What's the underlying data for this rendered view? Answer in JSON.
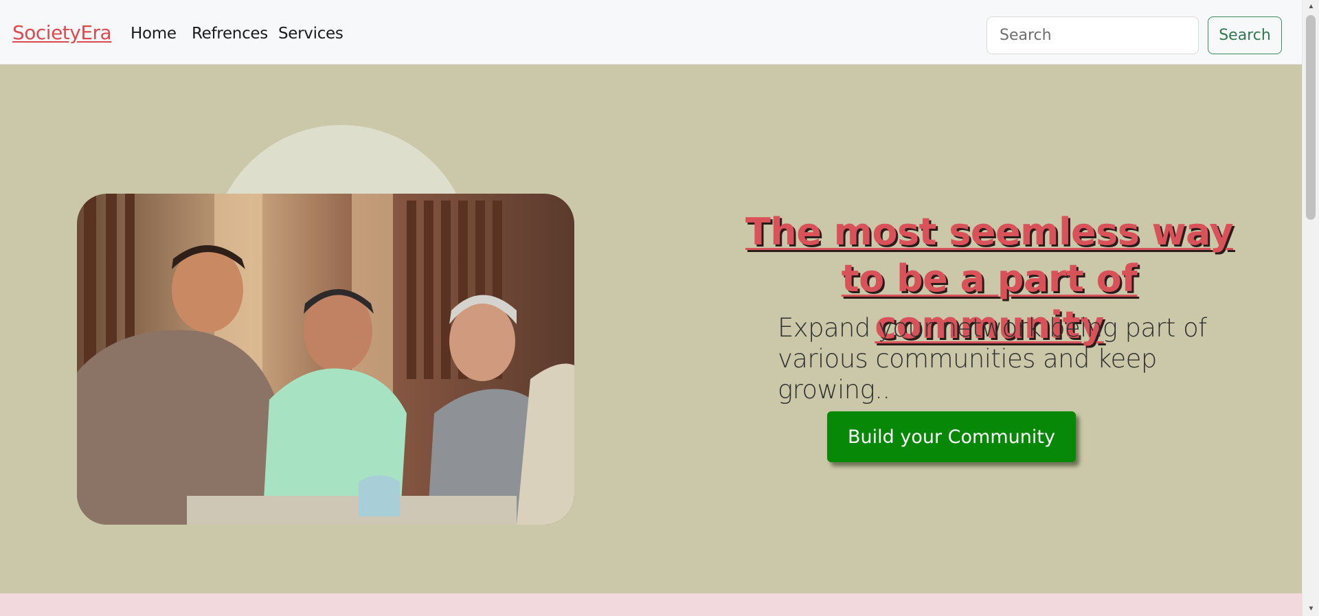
{
  "navbar": {
    "brand": "SocietyEra",
    "links": [
      "Home",
      "Refrences",
      "Services"
    ],
    "search": {
      "placeholder": "Search",
      "button_label": "Search"
    }
  },
  "hero": {
    "headline": "The most seemless way to be a part of community",
    "subtext": "Expand your network being part of various communities and keep growing..",
    "cta_label": "Build your Community",
    "image_alt": "Group of friends chatting and laughing over tea"
  },
  "colors": {
    "brand": "#dc4a4f",
    "hero_bg": "#cbc8a9",
    "cta_bg": "#078807",
    "search_border": "#3f8a5c",
    "footer_band": "#f1d9dd"
  }
}
